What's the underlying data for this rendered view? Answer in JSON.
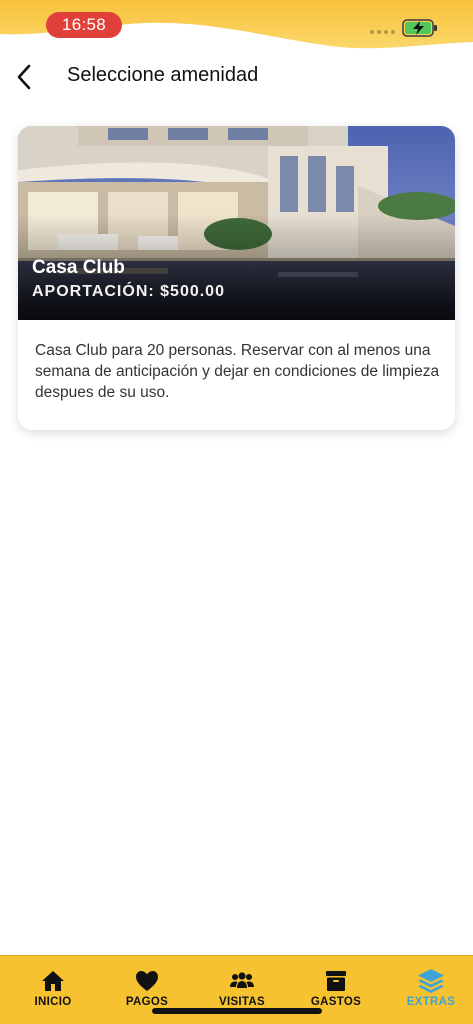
{
  "status_bar": {
    "time": "16:58"
  },
  "header": {
    "title": "Seleccione amenidad"
  },
  "amenity": {
    "name": "Casa Club",
    "price": "APORTACIÓN: $500.00",
    "description": "Casa Club para 20 personas. Reservar con al menos una semana de anticipación y dejar en condiciones de limpieza despues de su uso."
  },
  "tabs": [
    {
      "label": "INICIO",
      "icon": "home-icon"
    },
    {
      "label": "PAGOS",
      "icon": "heart-icon"
    },
    {
      "label": "VISITAS",
      "icon": "users-icon"
    },
    {
      "label": "GASTOS",
      "icon": "archive-box-icon"
    },
    {
      "label": "EXTRAS",
      "icon": "layers-icon",
      "active": true
    }
  ],
  "colors": {
    "accent": "#f6c230",
    "active_tab": "#3fa3d6",
    "time_pill": "#e0403a"
  }
}
